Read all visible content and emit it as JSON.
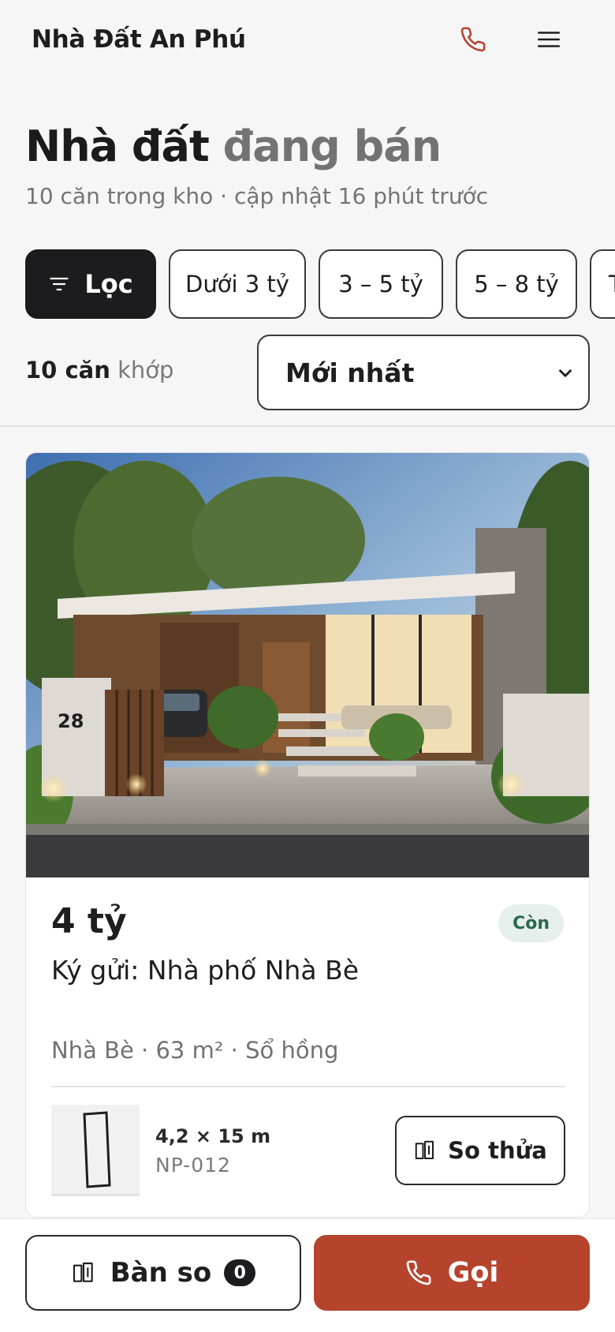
{
  "header": {
    "brand": "Nhà Đất An Phú",
    "phone_icon": "phone-icon",
    "menu_icon": "menu-icon"
  },
  "title": {
    "main": "Nhà đất",
    "accent": "đang bán"
  },
  "subtitle": "10 căn trong kho · cập nhật 16 phút trước",
  "filters": {
    "filter_label": "Lọc",
    "chips": [
      "Dưới 3 tỷ",
      "3 – 5 tỷ",
      "5 – 8 tỷ",
      "T"
    ]
  },
  "results": {
    "count": "10 căn",
    "count_suffix": "khớp"
  },
  "sort": {
    "selected": "Mới nhất"
  },
  "listing": {
    "house_number": "28",
    "price": "4 tỷ",
    "status": "Còn",
    "title": "Ký gửi: Nhà phố Nhà Bè",
    "meta": "Nhà Bè · 63 m² · Sổ hồng",
    "dims": "4,2 × 15 m",
    "code": "NP-012",
    "compare_label": "So thửa"
  },
  "bottom": {
    "tray_label": "Bàn so",
    "tray_count": "0",
    "call_label": "Gọi"
  },
  "colors": {
    "accent": "#b6432c",
    "dark": "#1c1c1e",
    "badge_bg": "#e6efeb",
    "badge_fg": "#2a6a4f"
  }
}
